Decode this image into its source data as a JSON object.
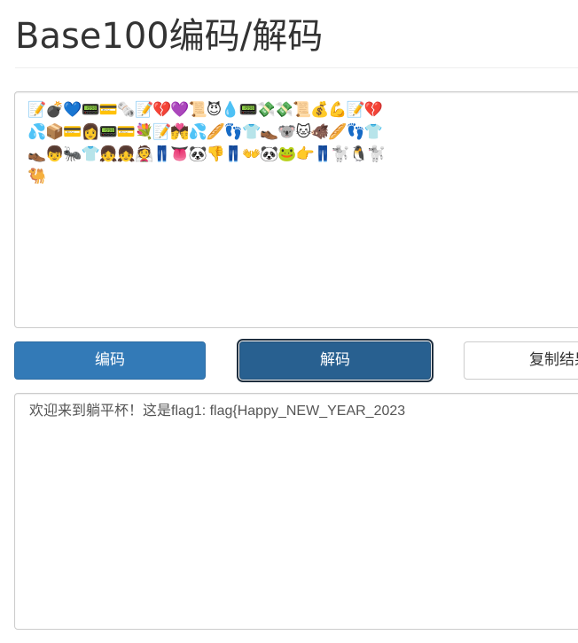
{
  "page": {
    "title": "Base100编码/解码"
  },
  "input": {
    "lines": [
      "📝💣💙📟💳🗞️📝💔💜📜😈💧📟💸💸📜💰💪📝💔",
      "💦📦💳👩📟💳💐📝💏💦🥖👣👕👞🐨🐱🐗🥖👣👕",
      "👞👦🐜👕👧👧👰👖👅🐼👎👖👐🐼🐸👉👖🐩🐧🐩",
      "🐫"
    ]
  },
  "buttons": {
    "encode_label": "编码",
    "decode_label": "解码",
    "copy_label": "复制结果"
  },
  "output": {
    "text": "欢迎来到躺平杯！这是flag1: flag{Happy_NEW_YEAR_2023"
  }
}
